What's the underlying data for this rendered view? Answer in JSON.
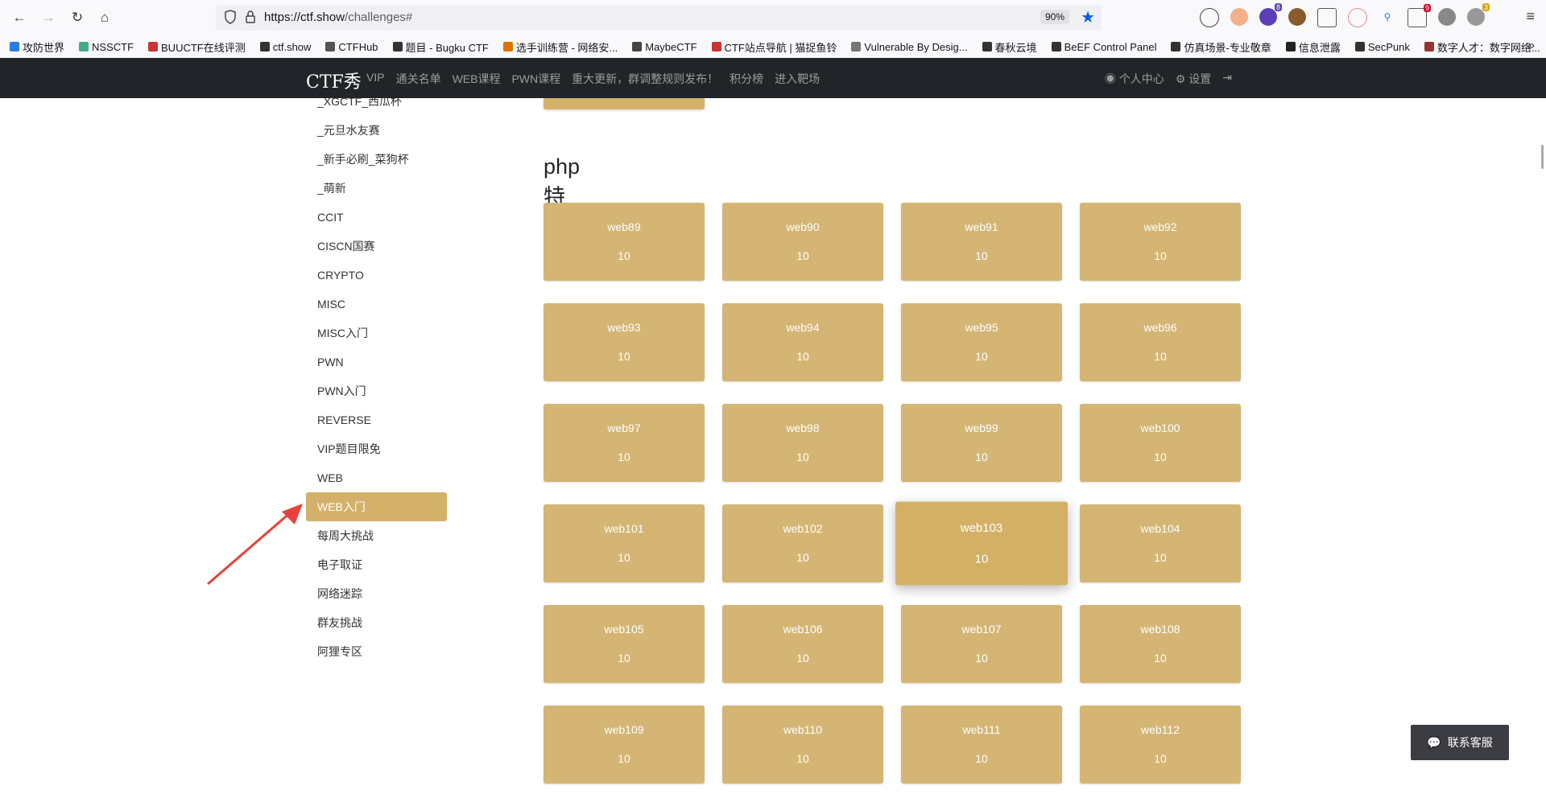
{
  "browser": {
    "url_host": "https://ctf.show",
    "url_path": "/challenges#",
    "zoom": "90%",
    "bookmarks": [
      "攻防世界",
      "NSSCTF",
      "BUUCTF在线评测",
      "ctf.show",
      "CTFHub",
      "题目 - Bugku CTF",
      "选手训练营 - 网络安...",
      "MaybeCTF",
      "CTF站点导航 | 猫捉鱼铃",
      "Vulnerable By Desig...",
      "春秋云境",
      "BeEF Control Panel",
      "仿真场景-专业敬章",
      "信息泄露",
      "SecPunk",
      "数字人才：数字网络..."
    ],
    "badges": {
      "ext2": "8",
      "ext9": "9",
      "ext11": "3"
    }
  },
  "nav": {
    "logo": "CTF秀",
    "links": [
      "VIP",
      "通关名单",
      "WEB课程",
      "PWN课程",
      "重大更新，群调整规则发布！",
      "积分榜",
      "进入靶场"
    ],
    "user_center": "个人中心",
    "settings": "设置"
  },
  "sidebar": {
    "items": [
      "_XGCTF_西瓜杯",
      "_元旦水友赛",
      "_新手必刷_菜狗杯",
      "_萌新",
      "CCIT",
      "CISCN国赛",
      "CRYPTO",
      "MISC",
      "MISC入门",
      "PWN",
      "PWN入门",
      "REVERSE",
      "VIP题目限免",
      "WEB",
      "WEB入门",
      "每周大挑战",
      "电子取证",
      "网络迷踪",
      "群友挑战",
      "阿狸专区"
    ],
    "active": "WEB入门"
  },
  "main": {
    "section_title": "php特性",
    "challenges": [
      {
        "name": "web89",
        "score": "10"
      },
      {
        "name": "web90",
        "score": "10"
      },
      {
        "name": "web91",
        "score": "10"
      },
      {
        "name": "web92",
        "score": "10"
      },
      {
        "name": "web93",
        "score": "10"
      },
      {
        "name": "web94",
        "score": "10"
      },
      {
        "name": "web95",
        "score": "10"
      },
      {
        "name": "web96",
        "score": "10"
      },
      {
        "name": "web97",
        "score": "10"
      },
      {
        "name": "web98",
        "score": "10"
      },
      {
        "name": "web99",
        "score": "10"
      },
      {
        "name": "web100",
        "score": "10"
      },
      {
        "name": "web101",
        "score": "10"
      },
      {
        "name": "web102",
        "score": "10"
      },
      {
        "name": "web103",
        "score": "10"
      },
      {
        "name": "web104",
        "score": "10"
      },
      {
        "name": "web105",
        "score": "10"
      },
      {
        "name": "web106",
        "score": "10"
      },
      {
        "name": "web107",
        "score": "10"
      },
      {
        "name": "web108",
        "score": "10"
      },
      {
        "name": "web109",
        "score": "10"
      },
      {
        "name": "web110",
        "score": "10"
      },
      {
        "name": "web111",
        "score": "10"
      },
      {
        "name": "web112",
        "score": "10"
      }
    ],
    "hovered": "web103"
  },
  "service_label": "联系客服",
  "colors": {
    "card": "#d4b574",
    "active": "#d4b169",
    "navbar": "#212529",
    "arrow": "#e8413a"
  }
}
